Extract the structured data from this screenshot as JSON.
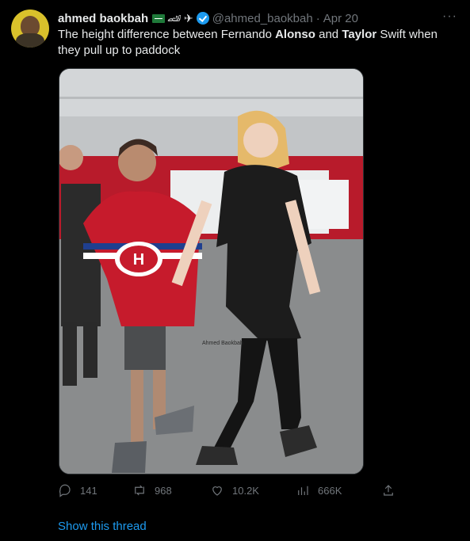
{
  "tweet": {
    "author_name": "ahmed baokbah",
    "author_emojis": [
      "🏎",
      "✈"
    ],
    "handle": "@ahmed_baokbah",
    "separator": "·",
    "date": "Apr 20",
    "more_label": "···",
    "text_parts": [
      "The height difference between Fernando ",
      "Alonso",
      " and ",
      "Taylor",
      " Swift when they pull up to paddock"
    ],
    "image_watermark": "Ahmed Baokbah",
    "reply_count": "141",
    "retweet_count": "968",
    "like_count": "10.2K",
    "view_count": "666K",
    "show_thread": "Show this thread"
  },
  "icons": {
    "avatar": "avatar",
    "flag": "saudi-flag-icon",
    "verified": "verified-badge-icon",
    "reply": "reply-icon",
    "retweet": "retweet-icon",
    "like": "heart-icon",
    "views": "views-chart-icon",
    "share": "share-icon"
  },
  "colors": {
    "background": "#000000",
    "text": "#e7e9ea",
    "muted": "#71767b",
    "accent": "#1d9bf0",
    "avatar_bg": "#d9c12b"
  }
}
